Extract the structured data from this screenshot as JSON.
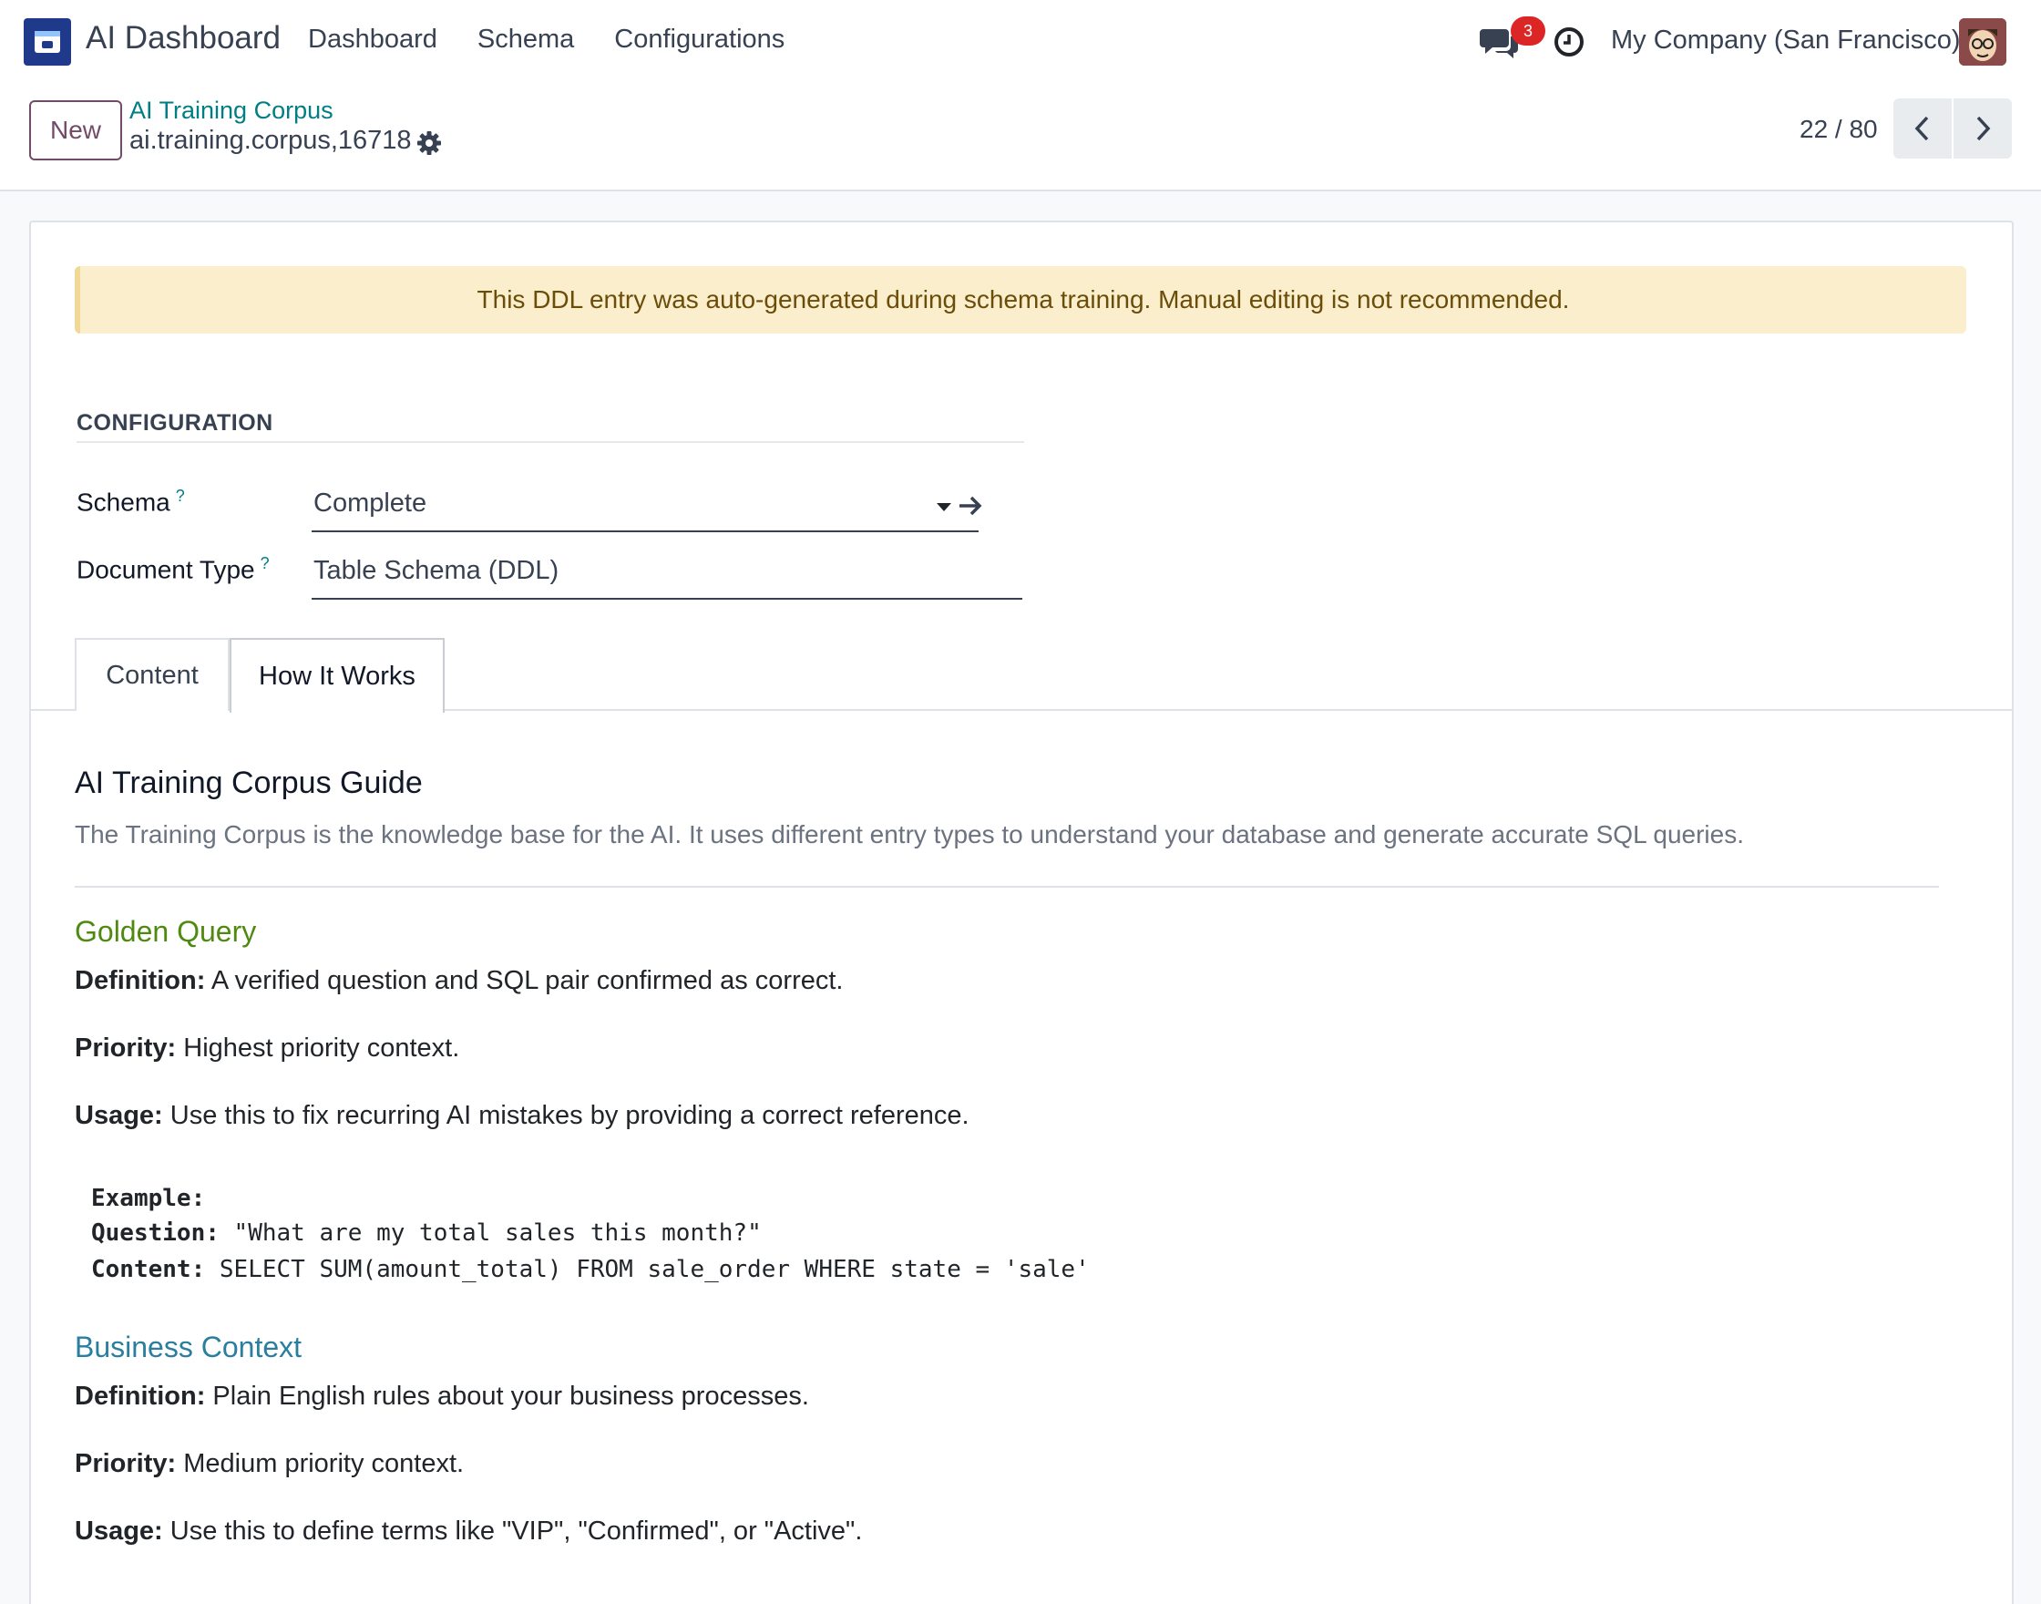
{
  "navbar": {
    "app_name": "AI Dashboard",
    "menu": [
      "Dashboard",
      "Schema",
      "Configurations"
    ],
    "chat_badge": "3",
    "company": "My Company (San Francisco)"
  },
  "control_panel": {
    "new_label": "New",
    "breadcrumb": "AI Training Corpus",
    "record_name": "ai.training.corpus,16718",
    "pager": "22 / 80"
  },
  "alert": "This DDL entry was auto-generated during schema training. Manual editing is not recommended.",
  "form": {
    "section_title": "CONFIGURATION",
    "schema_label": "Schema",
    "schema_value": "Complete",
    "doctype_label": "Document Type",
    "doctype_value": "Table Schema (DDL)",
    "help_mark": "?"
  },
  "tabs": [
    "Content",
    "How It Works"
  ],
  "active_tab": "How It Works",
  "guide": {
    "title": "AI Training Corpus Guide",
    "intro": "The Training Corpus is the knowledge base for the AI. It uses different entry types to understand your database and generate accurate SQL queries.",
    "golden": {
      "heading": "Golden Query",
      "definition_label": "Definition:",
      "definition": " A verified question and SQL pair confirmed as correct.",
      "priority_label": "Priority:",
      "priority": " Highest priority context.",
      "usage_label": "Usage:",
      "usage": " Use this to fix recurring AI mistakes by providing a correct reference.",
      "example_label": "Example:",
      "question_label": "Question:",
      "question": " \"What are my total sales this month?\"",
      "content_label": "Content:",
      "content": " SELECT SUM(amount_total) FROM sale_order WHERE state = 'sale'"
    },
    "business": {
      "heading": "Business Context",
      "definition_label": "Definition:",
      "definition": " Plain English rules about your business processes.",
      "priority_label": "Priority:",
      "priority": " Medium priority context.",
      "usage_label": "Usage:",
      "usage": " Use this to define terms like \"VIP\", \"Confirmed\", or \"Active\"."
    }
  }
}
